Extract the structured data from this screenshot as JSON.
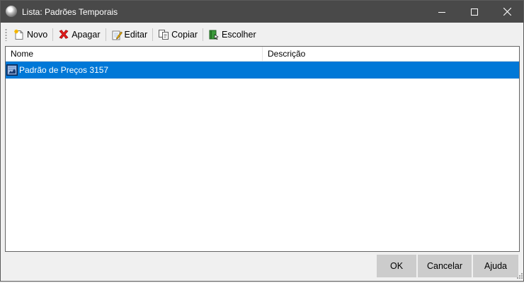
{
  "window": {
    "title": "Lista: Padrões Temporais",
    "controls": {
      "minimize": "minimize-icon",
      "maximize": "maximize-icon",
      "close": "close-icon"
    }
  },
  "toolbar": {
    "novo": "Novo",
    "apagar": "Apagar",
    "editar": "Editar",
    "copiar": "Copiar",
    "escolher": "Escolher"
  },
  "list": {
    "columns": [
      {
        "label": "Nome"
      },
      {
        "label": "Descrição"
      }
    ],
    "rows": [
      {
        "name": "Padrão de Preços 3157",
        "description": "",
        "selected": true
      }
    ]
  },
  "buttons": {
    "ok": "OK",
    "cancelar": "Cancelar",
    "ajuda": "Ajuda"
  },
  "colors": {
    "titlebar": "#494949",
    "selection": "#0078d7",
    "button": "#cccccc"
  }
}
